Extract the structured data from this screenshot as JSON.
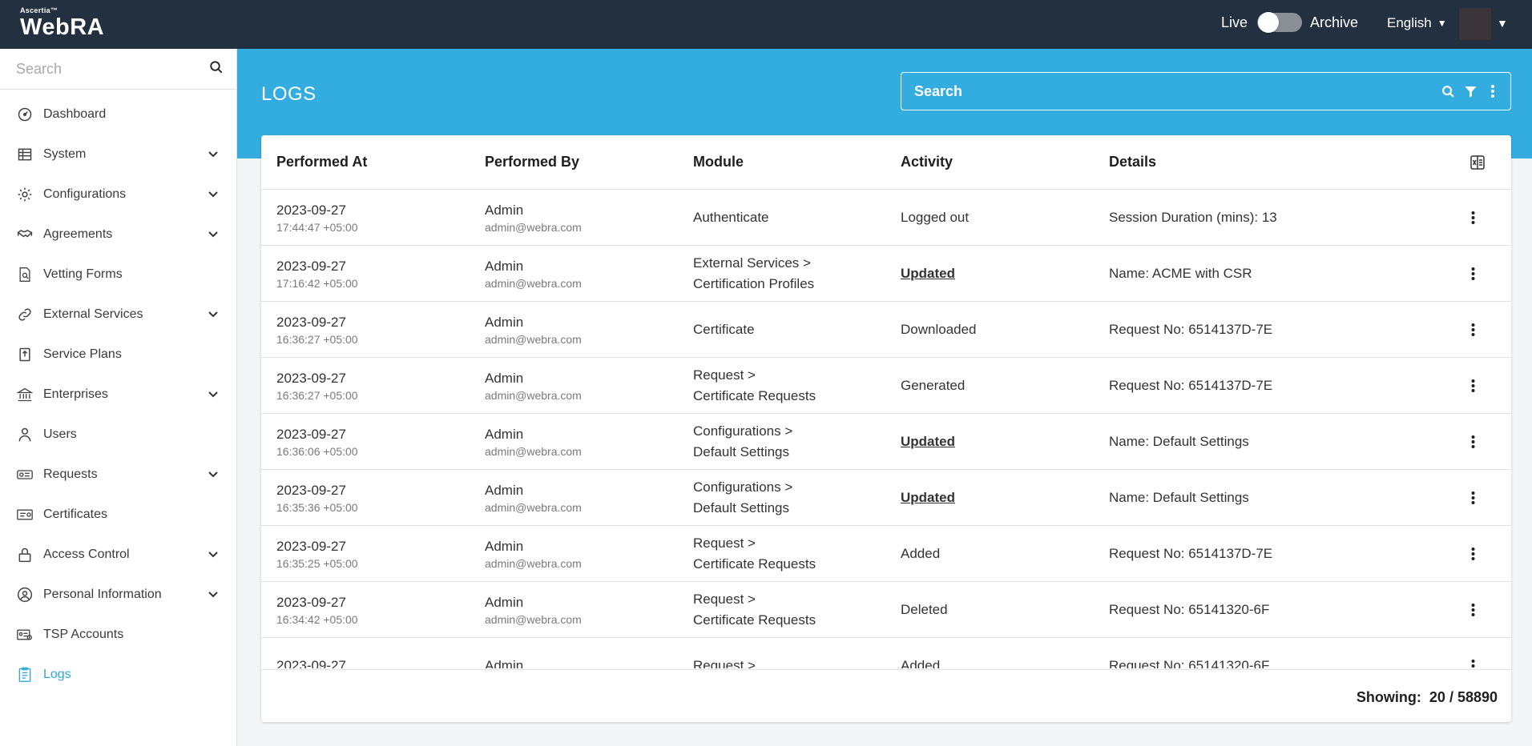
{
  "header": {
    "brand_small": "Ascertia™",
    "brand_name": "WebRA",
    "live_label": "Live",
    "archive_label": "Archive",
    "language": "English"
  },
  "sidebar": {
    "search_placeholder": "Search",
    "items": [
      {
        "label": "Dashboard",
        "icon": "dashboard-icon",
        "expandable": false
      },
      {
        "label": "System",
        "icon": "system-icon",
        "expandable": true
      },
      {
        "label": "Configurations",
        "icon": "gear-icon",
        "expandable": true
      },
      {
        "label": "Agreements",
        "icon": "handshake-icon",
        "expandable": true
      },
      {
        "label": "Vetting Forms",
        "icon": "form-search-icon",
        "expandable": false
      },
      {
        "label": "External Services",
        "icon": "link-icon",
        "expandable": true
      },
      {
        "label": "Service Plans",
        "icon": "plan-icon",
        "expandable": false
      },
      {
        "label": "Enterprises",
        "icon": "bank-icon",
        "expandable": true
      },
      {
        "label": "Users",
        "icon": "user-icon",
        "expandable": false
      },
      {
        "label": "Requests",
        "icon": "requests-icon",
        "expandable": true
      },
      {
        "label": "Certificates",
        "icon": "certificate-icon",
        "expandable": false
      },
      {
        "label": "Access Control",
        "icon": "lock-icon",
        "expandable": true
      },
      {
        "label": "Personal Information",
        "icon": "profile-icon",
        "expandable": true
      },
      {
        "label": "TSP Accounts",
        "icon": "tsp-account-icon",
        "expandable": false
      },
      {
        "label": "Logs",
        "icon": "logs-icon",
        "expandable": false,
        "active": true
      }
    ]
  },
  "main": {
    "title": "LOGS",
    "search_placeholder": "Search",
    "columns": [
      "Performed At",
      "Performed By",
      "Module",
      "Activity",
      "Details"
    ],
    "rows": [
      {
        "date": "2023-09-27",
        "time": "17:44:47 +05:00",
        "user": "Admin",
        "email": "admin@webra.com",
        "module1": "Authenticate",
        "module2": "",
        "activity": "Logged out",
        "activity_link": false,
        "details": "Session Duration (mins): 13"
      },
      {
        "date": "2023-09-27",
        "time": "17:16:42 +05:00",
        "user": "Admin",
        "email": "admin@webra.com",
        "module1": "External Services >",
        "module2": "Certification Profiles",
        "activity": "Updated",
        "activity_link": true,
        "details": "Name: ACME with CSR"
      },
      {
        "date": "2023-09-27",
        "time": "16:36:27 +05:00",
        "user": "Admin",
        "email": "admin@webra.com",
        "module1": "Certificate",
        "module2": "",
        "activity": "Downloaded",
        "activity_link": false,
        "details": "Request No: 6514137D-7E"
      },
      {
        "date": "2023-09-27",
        "time": "16:36:27 +05:00",
        "user": "Admin",
        "email": "admin@webra.com",
        "module1": "Request >",
        "module2": "Certificate Requests",
        "activity": "Generated",
        "activity_link": false,
        "details": "Request No: 6514137D-7E"
      },
      {
        "date": "2023-09-27",
        "time": "16:36:06 +05:00",
        "user": "Admin",
        "email": "admin@webra.com",
        "module1": "Configurations >",
        "module2": "Default Settings",
        "activity": "Updated",
        "activity_link": true,
        "details": "Name: Default Settings"
      },
      {
        "date": "2023-09-27",
        "time": "16:35:36 +05:00",
        "user": "Admin",
        "email": "admin@webra.com",
        "module1": "Configurations >",
        "module2": "Default Settings",
        "activity": "Updated",
        "activity_link": true,
        "details": "Name: Default Settings"
      },
      {
        "date": "2023-09-27",
        "time": "16:35:25 +05:00",
        "user": "Admin",
        "email": "admin@webra.com",
        "module1": "Request >",
        "module2": "Certificate Requests",
        "activity": "Added",
        "activity_link": false,
        "details": "Request No: 6514137D-7E"
      },
      {
        "date": "2023-09-27",
        "time": "16:34:42 +05:00",
        "user": "Admin",
        "email": "admin@webra.com",
        "module1": "Request >",
        "module2": "Certificate Requests",
        "activity": "Deleted",
        "activity_link": false,
        "details": "Request No: 65141320-6F"
      },
      {
        "date": "2023-09-27",
        "time": "",
        "user": "Admin",
        "email": "",
        "module1": "Request >",
        "module2": "",
        "activity": "Added",
        "activity_link": false,
        "details": "Request No: 65141320-6F"
      }
    ],
    "showing_label": "Showing:",
    "showing_value": "20 / 58890"
  }
}
